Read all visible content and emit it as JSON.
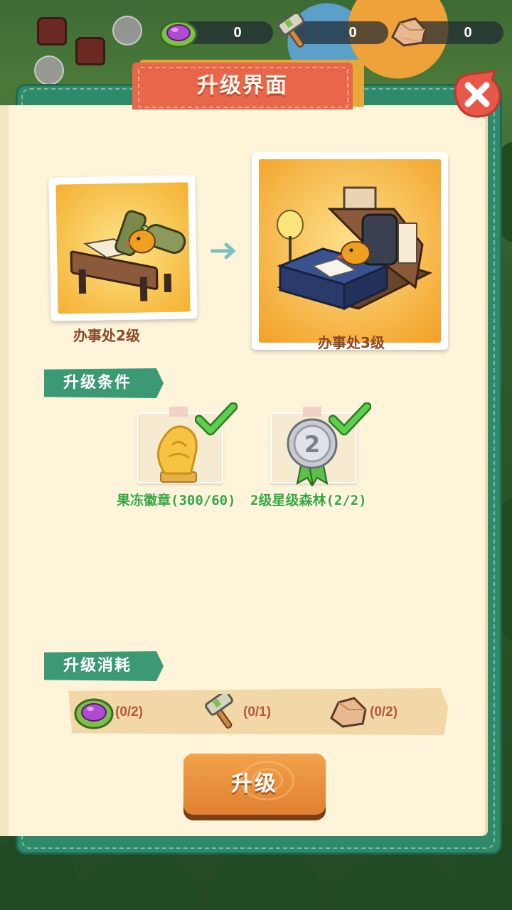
{
  "resources": [
    {
      "icon": "jelly-cabbage-icon",
      "value": "0"
    },
    {
      "icon": "hammer-icon",
      "value": "0"
    },
    {
      "icon": "stone-icon",
      "value": "0"
    }
  ],
  "dialog": {
    "title": "升级界面",
    "close_icon": "close-icon"
  },
  "upgrade": {
    "current": {
      "label": "办事处2级"
    },
    "next": {
      "label": "办事处3级"
    }
  },
  "conditions": {
    "heading": "升级条件",
    "items": [
      {
        "icon": "jelly-badge-icon",
        "text": "果冻徽章(300/60)",
        "met": true
      },
      {
        "icon": "silver-medal-icon",
        "text": "2级星级森林(2/2)",
        "met": true
      }
    ]
  },
  "costs": {
    "heading": "升级消耗",
    "items": [
      {
        "icon": "jelly-cabbage-icon",
        "value": "(0/2)"
      },
      {
        "icon": "hammer-icon",
        "value": "(0/1)"
      },
      {
        "icon": "stone-icon",
        "value": "(0/2)"
      }
    ]
  },
  "upgrade_button": {
    "label": "升级"
  },
  "colors": {
    "panel_green": "#2e8a6a",
    "page": "#fdf4da",
    "banner": "#e8674a",
    "tag": "#3b9a74",
    "condition_text": "#3aa53a",
    "button": "#e08030"
  }
}
